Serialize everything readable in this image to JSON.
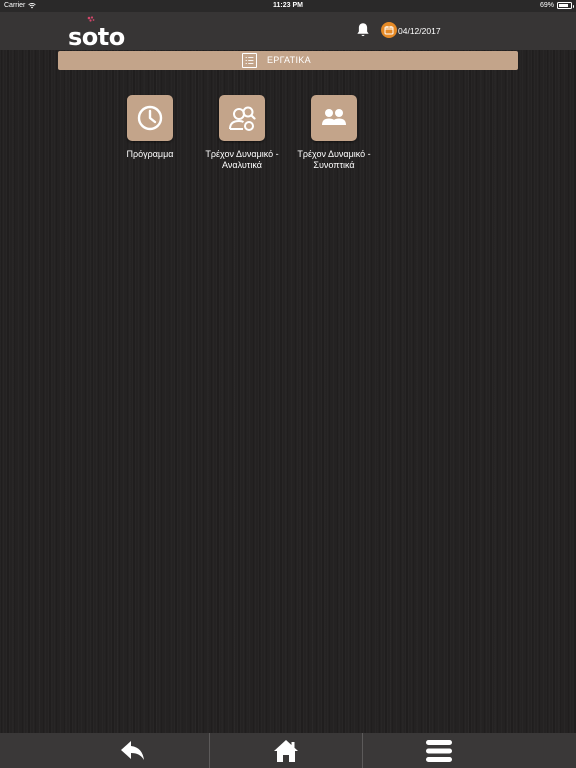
{
  "status_bar": {
    "carrier": "Carrier",
    "time": "11:23 PM",
    "battery": "69%",
    "battery_level": 0.69,
    "icons": [
      "wifi-icon",
      "battery-icon"
    ]
  },
  "header": {
    "logo_text": "soto",
    "date": "04/12/2017",
    "icons": [
      "bell-icon",
      "calendar-icon"
    ],
    "badge_color": "#e58a27"
  },
  "section": {
    "title": "ΕΡΓΑΤΙΚΑ",
    "icon": "list-icon"
  },
  "tiles": [
    {
      "label": "Πρόγραμμα",
      "icon": "clock-icon"
    },
    {
      "label": "Τρέχον Δυναμικό - Αναλυτικά",
      "icon": "user-search-icon"
    },
    {
      "label": "Τρέχον Δυναμικό - Συνοπτικά",
      "icon": "users-icon"
    }
  ],
  "bottom_nav": {
    "items": [
      {
        "name": "back",
        "icon": "back-arrow-icon"
      },
      {
        "name": "home",
        "icon": "home-icon"
      },
      {
        "name": "menu",
        "icon": "hamburger-menu-icon"
      }
    ]
  },
  "colors": {
    "accent": "#c3a48a",
    "background": "#242222",
    "header": "#373535",
    "footer": "#3a3838"
  }
}
